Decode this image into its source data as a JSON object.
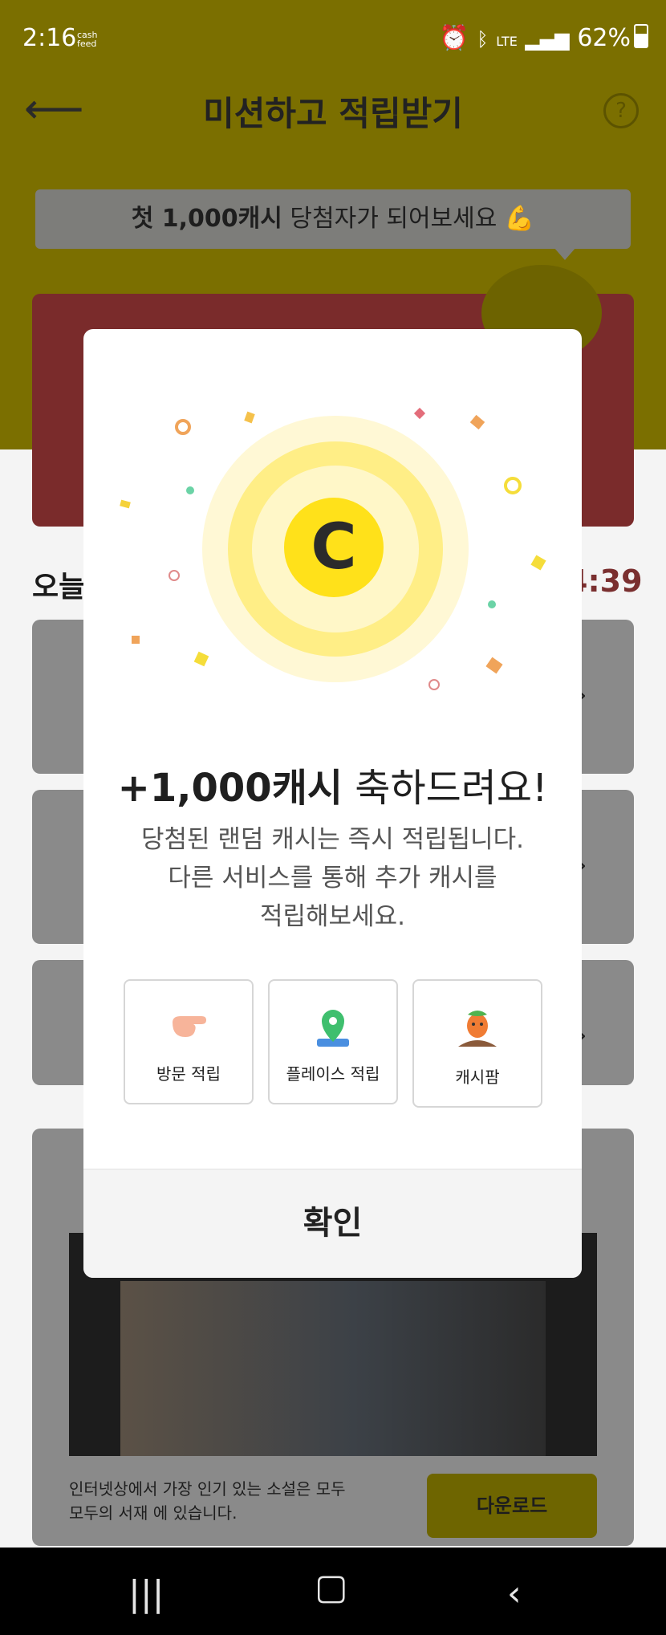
{
  "status_bar": {
    "time": "2:16",
    "app_badge": "cash feed",
    "battery": "62%",
    "network": "LTE"
  },
  "header": {
    "title": "미션하고 적립받기",
    "help_symbol": "?",
    "bubble_strong": "첫 1,000캐시",
    "bubble_rest": " 당첨자가 되어보세요 💪"
  },
  "background": {
    "section_title": "오늘",
    "timer": "4:39",
    "ad_text_line1": "인터넷상에서 가장 인기 있는 소설은 모두",
    "ad_text_line2": "모두의 서재 에 있습니다.",
    "download_label": "다운로드"
  },
  "modal": {
    "coin_letter": "C",
    "headline_strong": "+1,000캐시",
    "headline_rest": " 축하드려요!",
    "desc_lines": [
      "당첨된 랜덤 캐시는 즉시 적립됩니다.",
      "다른 서비스를 통해 추가 캐시를",
      "적립해보세요."
    ],
    "options": [
      {
        "label": "방문 적립",
        "icon": "pointing-hand-icon"
      },
      {
        "label": "플레이스 적립",
        "icon": "map-pin-icon"
      },
      {
        "label": "캐시팜",
        "icon": "carrot-icon"
      }
    ],
    "confirm_label": "확인"
  },
  "colors": {
    "brand_yellow": "#ffe11a",
    "dim_header": "#7b6f00",
    "timer_red": "#7a2f2f"
  }
}
